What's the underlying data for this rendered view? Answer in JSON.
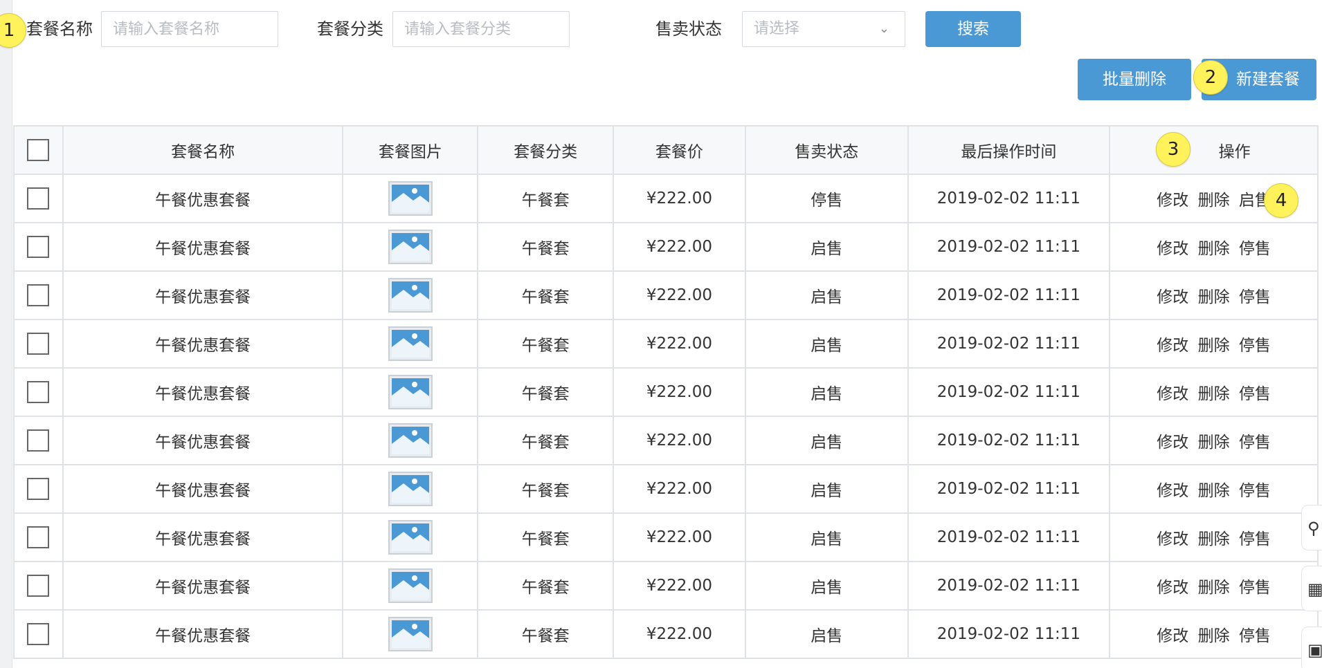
{
  "search": {
    "name_label": "套餐名称",
    "name_placeholder": "请输入套餐名称",
    "category_label": "套餐分类",
    "category_placeholder": "请输入套餐分类",
    "status_label": "售卖状态",
    "status_placeholder": "请选择",
    "search_button": "搜索"
  },
  "actions": {
    "batch_delete": "批量删除",
    "new_package": "新建套餐"
  },
  "badges": [
    "1",
    "2",
    "3",
    "4"
  ],
  "table": {
    "headers": [
      "套餐名称",
      "套餐图片",
      "套餐分类",
      "套餐价",
      "售卖状态",
      "最后操作时间",
      "操作"
    ],
    "rows": [
      {
        "name": "午餐优惠套餐",
        "category": "午餐套",
        "price": "¥222.00",
        "status": "停售",
        "time": "2019-02-02 11:11",
        "edit": "修改",
        "delete": "删除",
        "toggle": "启售"
      },
      {
        "name": "午餐优惠套餐",
        "category": "午餐套",
        "price": "¥222.00",
        "status": "启售",
        "time": "2019-02-02 11:11",
        "edit": "修改",
        "delete": "删除",
        "toggle": "停售"
      },
      {
        "name": "午餐优惠套餐",
        "category": "午餐套",
        "price": "¥222.00",
        "status": "启售",
        "time": "2019-02-02 11:11",
        "edit": "修改",
        "delete": "删除",
        "toggle": "停售"
      },
      {
        "name": "午餐优惠套餐",
        "category": "午餐套",
        "price": "¥222.00",
        "status": "启售",
        "time": "2019-02-02 11:11",
        "edit": "修改",
        "delete": "删除",
        "toggle": "停售"
      },
      {
        "name": "午餐优惠套餐",
        "category": "午餐套",
        "price": "¥222.00",
        "status": "启售",
        "time": "2019-02-02 11:11",
        "edit": "修改",
        "delete": "删除",
        "toggle": "停售"
      },
      {
        "name": "午餐优惠套餐",
        "category": "午餐套",
        "price": "¥222.00",
        "status": "启售",
        "time": "2019-02-02 11:11",
        "edit": "修改",
        "delete": "删除",
        "toggle": "停售"
      },
      {
        "name": "午餐优惠套餐",
        "category": "午餐套",
        "price": "¥222.00",
        "status": "启售",
        "time": "2019-02-02 11:11",
        "edit": "修改",
        "delete": "删除",
        "toggle": "停售"
      },
      {
        "name": "午餐优惠套餐",
        "category": "午餐套",
        "price": "¥222.00",
        "status": "启售",
        "time": "2019-02-02 11:11",
        "edit": "修改",
        "delete": "删除",
        "toggle": "停售"
      },
      {
        "name": "午餐优惠套餐",
        "category": "午餐套",
        "price": "¥222.00",
        "status": "启售",
        "time": "2019-02-02 11:11",
        "edit": "修改",
        "delete": "删除",
        "toggle": "停售"
      },
      {
        "name": "午餐优惠套餐",
        "category": "午餐套",
        "price": "¥222.00",
        "status": "启售",
        "time": "2019-02-02 11:11",
        "edit": "修改",
        "delete": "删除",
        "toggle": "停售"
      }
    ]
  },
  "side_tools": [
    "search-icon",
    "grid-icon",
    "image-icon"
  ],
  "colors": {
    "primary": "#4a98d4",
    "badge": "#fff25a",
    "border": "#dfe3e8",
    "thumb": "#4a98d4"
  }
}
